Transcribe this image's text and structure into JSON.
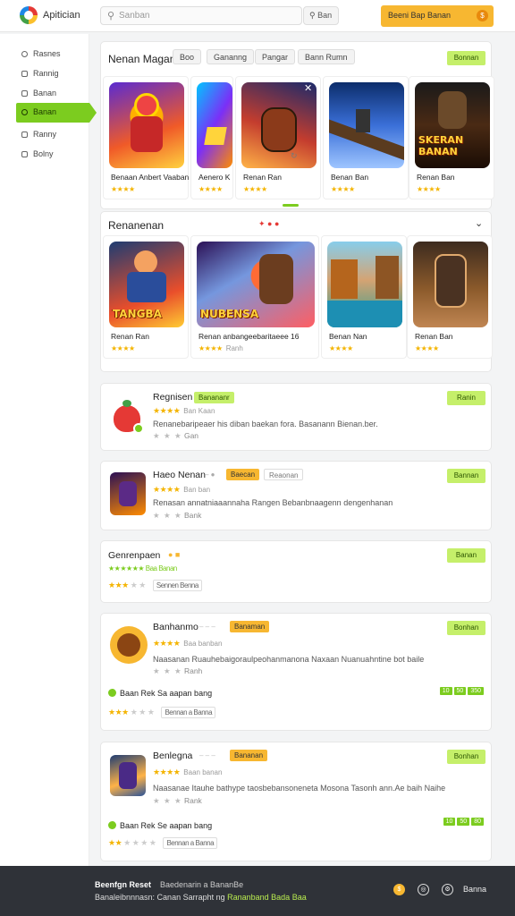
{
  "header": {
    "app_name": "Apitician",
    "search_placeholder": "Sanban",
    "search_button": "Ban",
    "promo_label": "Beeni Bap Banan",
    "promo_icon": "coin-icon"
  },
  "sidebar": {
    "items": [
      {
        "label": "Rasnes",
        "icon": "circle-icon"
      },
      {
        "label": "Rannig",
        "icon": "square-icon"
      },
      {
        "label": "Banan",
        "icon": "square-icon"
      },
      {
        "label": "Banan",
        "icon": "circle-icon",
        "active": true
      },
      {
        "label": "Ranny",
        "icon": "square-icon"
      },
      {
        "label": "Bolny",
        "icon": "square-icon"
      }
    ]
  },
  "featured": {
    "title": "Nenan Magan",
    "chips": [
      "Boo",
      "Gananng",
      "Pangar",
      "Bann Rumn"
    ],
    "action": "Bonnan",
    "games": [
      {
        "name": "Benaan Anbert Vaaban",
        "stars": "★★★★",
        "muted": ""
      },
      {
        "name": "Aenero K",
        "stars": "★★★★",
        "muted": ""
      },
      {
        "name": "Renan Ran",
        "stars": "★★★★",
        "muted": ""
      },
      {
        "name": "Benan Ban",
        "stars": "★★★★",
        "muted": ""
      },
      {
        "name": "Renan Ban",
        "stars": "★★★★",
        "muted": ""
      }
    ],
    "art_text": [
      "",
      "",
      "",
      "",
      "SKERAN BANAN"
    ]
  },
  "second": {
    "title": "Renanenan",
    "games": [
      {
        "name": "Renan Ran",
        "stars": "★★★★"
      },
      {
        "name": "Renan anbangeebaritaeee 16",
        "stars": "★★★★",
        "muted": "Ranh"
      },
      {
        "name": "Benan Nan",
        "stars": "★★★★"
      },
      {
        "name": "Renan Ban",
        "stars": "★★★★"
      }
    ],
    "art_text": [
      "TANGBA",
      "NUBENSA",
      "",
      ""
    ]
  },
  "list": [
    {
      "title": "Regnisen",
      "badge": "Banananr",
      "stars": "★★★★",
      "muted": "Ban Kaan",
      "desc": "Renanebaripeaer his diban baekan fora. Basanann Bienan.ber.",
      "gray": "Gan",
      "action": "Ranin"
    },
    {
      "title": "Haeo Nenan",
      "badge": "Baecan",
      "badge2": "Reaonan",
      "stars": "★★★★",
      "muted": "Ban ban",
      "desc": "Renasan annatniaaannaha Rangen Bebanbnaagenn dengenhanan",
      "gray": "Bank",
      "action": "Bannan"
    },
    {
      "title": "Genrenpaen",
      "badge": "",
      "stars_green": "★★★★★★ Baa Banan",
      "stars": "★★★",
      "muted": "",
      "gray": "Sennen Benna",
      "action": "Banan"
    },
    {
      "title": "Banhanmo",
      "badge": "Banaman",
      "stars": "★★★★",
      "muted": "Baa banban",
      "desc": "Naasanan Ruauhebaigoraulpeohanmanona Naxaan Nuanuahntine bot baile",
      "gray": "Ranh",
      "extra": "Baan Rek Sa aapan bang",
      "extra_stars": "★★★",
      "extra_gray": "Bennan a Banna",
      "tags": [
        "10",
        "50",
        "350"
      ],
      "action": "Bonhan"
    },
    {
      "title": "Benlegna",
      "badge": "Bananan",
      "stars": "★★★★",
      "muted": "Baan banan",
      "desc": "Naasanae Itauhe bathype taosbebansoneneta Mosona Tasonh ann.Ae baih Naihe",
      "gray": "Rank",
      "extra": "Baan Rek Se aapan bang",
      "extra_stars": "★★",
      "extra_gray": "Bennan a Banna",
      "tags": [
        "10",
        "50",
        "80"
      ],
      "action": "Bonhan"
    }
  ],
  "footer": {
    "line1_bold": "Beenfgn Reset",
    "line1_rest": "Baedenarin a BananBe",
    "line2": "Banaleibnnnasn: Canan Sarrapht ng",
    "line2_green": "Rananband Bada Baa",
    "label": "Banna"
  },
  "colors": {
    "accent_green": "#7ccc1f",
    "promo_yellow": "#f7b731",
    "star": "#f4b400",
    "footer_bg": "#2f3238"
  }
}
